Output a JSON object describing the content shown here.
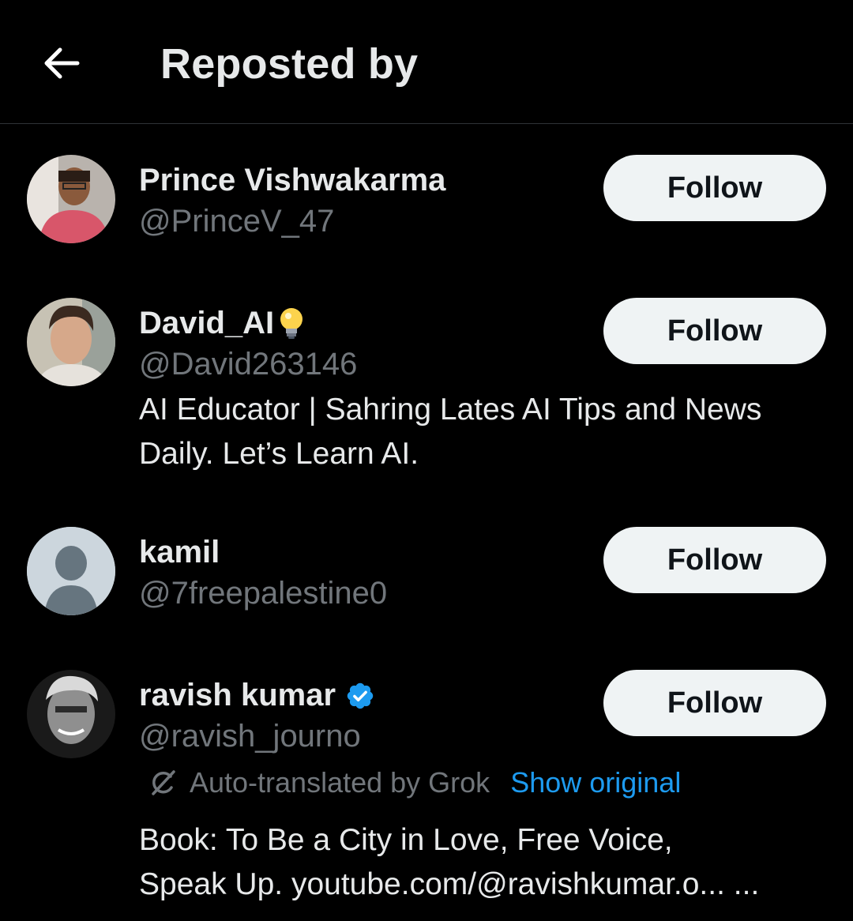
{
  "header": {
    "title": "Reposted by",
    "back_icon": "arrow-left-icon"
  },
  "users": [
    {
      "name": "Prince Vishwakarma",
      "handle": "@PrinceV_47",
      "follow_label": "Follow",
      "avatar": "photo-avatar"
    },
    {
      "name": "David_AI",
      "name_emoji": "lightbulb-icon",
      "handle": "@David263146",
      "bio_line1": "AI Educator | Sahring Lates AI Tips and News",
      "bio_line2": "Daily. Let’s Learn AI.",
      "follow_label": "Follow",
      "avatar": "photo-avatar"
    },
    {
      "name": "kamil",
      "handle": "@7freepalestine0",
      "follow_label": "Follow",
      "avatar": "default-avatar"
    },
    {
      "name": "ravish kumar",
      "badge": "verified-badge-icon",
      "handle": "@ravish_journo",
      "translate_note": "Auto-translated by Grok",
      "translate_link": "Show original",
      "bio_line1": "Book: To Be a City in Love, Free Voice,",
      "bio_line2": "Speak Up. youtube.com/@ravishkumar.o... ...",
      "follow_label": "Follow",
      "avatar": "photo-avatar"
    }
  ],
  "colors": {
    "background": "#000000",
    "text_primary": "#e7e9ea",
    "text_secondary": "#71767b",
    "link": "#1d9bf0",
    "button_bg": "#eff3f4",
    "button_text": "#0f1419",
    "divider": "#2f3336"
  }
}
